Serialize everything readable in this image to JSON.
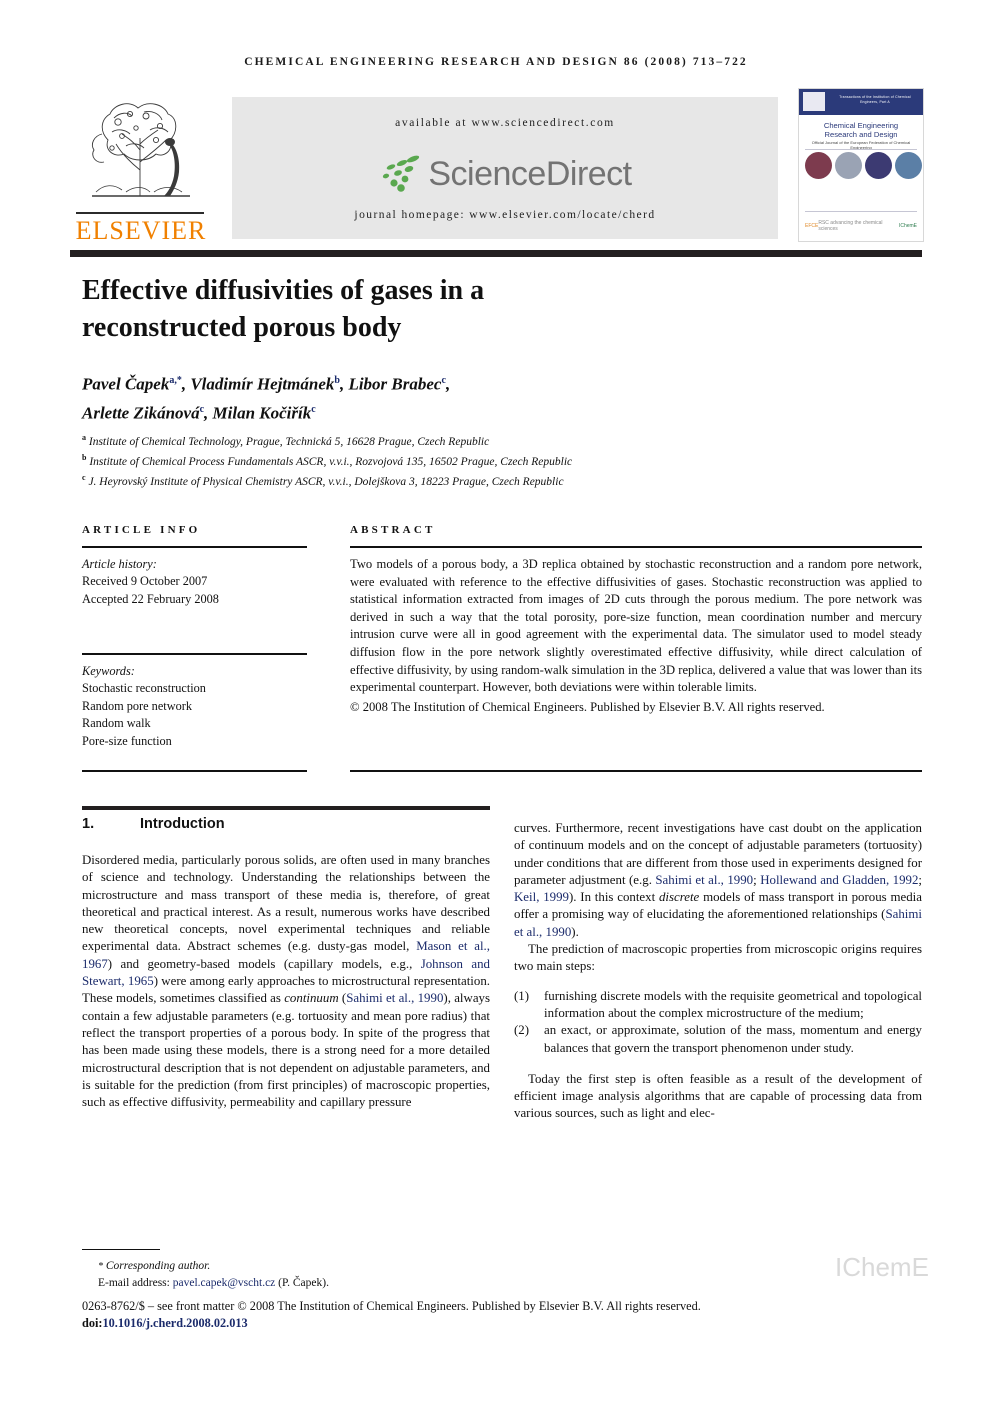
{
  "running_head": "CHEMICAL ENGINEERING RESEARCH AND DESIGN 86 (2008) 713–722",
  "masthead": {
    "publisher_name": "ELSEVIER",
    "available_at": "available at www.sciencedirect.com",
    "sciencedirect_wordmark": "ScienceDirect",
    "journal_homepage": "journal homepage: www.elsevier.com/locate/cherd",
    "cover": {
      "band_text": "Transactions of the Institution of Chemical Engineers, Part A",
      "title_line1": "Chemical Engineering",
      "title_line2": "Research and Design",
      "subtitle": "Official Journal of the European Federation of Chemical Engineering",
      "footer_logos": [
        "EFCE",
        "RSC advancing the chemical sciences",
        "IChemE"
      ]
    }
  },
  "article": {
    "title_line1": "Effective diffusivities of gases in a",
    "title_line2": "reconstructed porous body",
    "authors": [
      {
        "name": "Pavel Čapek",
        "marks": "a,*"
      },
      {
        "name": "Vladimír Hejtmánek",
        "marks": "b"
      },
      {
        "name": "Libor Brabec",
        "marks": "c"
      },
      {
        "name": "Arlette Zikánová",
        "marks": "c"
      },
      {
        "name": "Milan Kočiřík",
        "marks": "c"
      }
    ],
    "affiliations": [
      {
        "mark": "a",
        "text": "Institute of Chemical Technology, Prague, Technická 5, 16628 Prague, Czech Republic"
      },
      {
        "mark": "b",
        "text": "Institute of Chemical Process Fundamentals ASCR, v.v.i., Rozvojová 135, 16502 Prague, Czech Republic"
      },
      {
        "mark": "c",
        "text": "J. Heyrovský Institute of Physical Chemistry ASCR, v.v.i., Dolejškova 3, 18223 Prague, Czech Republic"
      }
    ]
  },
  "article_info": {
    "heading": "ARTICLE INFO",
    "history_label": "Article history:",
    "received": "Received 9 October 2007",
    "accepted": "Accepted 22 February 2008",
    "keywords_label": "Keywords:",
    "keywords": [
      "Stochastic reconstruction",
      "Random pore network",
      "Random walk",
      "Pore-size function"
    ]
  },
  "abstract": {
    "heading": "ABSTRACT",
    "body": "Two models of a porous body, a 3D replica obtained by stochastic reconstruction and a random pore network, were evaluated with reference to the effective diffusivities of gases. Stochastic reconstruction was applied to statistical information extracted from images of 2D cuts through the porous medium. The pore network was derived in such a way that the total porosity, pore-size function, mean coordination number and mercury intrusion curve were all in good agreement with the experimental data. The simulator used to model steady diffusion flow in the pore network slightly overestimated effective diffusivity, while direct calculation of effective diffusivity, by using random-walk simulation in the 3D replica, delivered a value that was lower than its experimental counterpart. However, both deviations were within tolerable limits.",
    "copyright": "© 2008 The Institution of Chemical Engineers. Published by Elsevier B.V. All rights reserved."
  },
  "section": {
    "number": "1.",
    "title": "Introduction"
  },
  "body": {
    "left_p1_a": "Disordered media, particularly porous solids, are often used in many branches of science and technology. Understanding the relationships between the microstructure and mass transport of these media is, therefore, of great theoretical and practical interest. As a result, numerous works have described new theoretical concepts, novel experimental techniques and reliable experimental data. Abstract schemes (e.g. dusty-gas model, ",
    "ref_mason": "Mason et al., 1967",
    "left_p1_b": ") and geometry-based models (capillary models, e.g., ",
    "ref_johnson": "Johnson and Stewart, 1965",
    "left_p1_c": ") were among early approaches to microstructural representation. These models, sometimes classified as ",
    "left_p1_continuum": "continuum",
    "left_p1_d": " (",
    "ref_sahimi1": "Sahimi et al., 1990",
    "left_p1_e": "), always contain a few adjustable parameters (e.g. tortuosity and mean pore radius) that reflect the transport properties of a porous body. In spite of the progress that has been made using these models, there is a strong need for a more detailed microstructural description that is not dependent on adjustable parameters, and is suitable for the prediction (from first principles) of macroscopic properties, such as effective diffusivity, permeability and capillary pressure",
    "right_p1_a": "curves. Furthermore, recent investigations have cast doubt on the application of continuum models and on the concept of adjustable parameters (tortuosity) under conditions that are different from those used in experiments designed for parameter adjustment (e.g. ",
    "ref_sahimi2": "Sahimi et al., 1990",
    "right_sep1": "; ",
    "ref_hollewand": "Hollewand and Gladden, 1992",
    "right_sep2": "; ",
    "ref_keil": "Keil, 1999",
    "right_p1_b": "). In this context ",
    "right_p1_discrete": "discrete",
    "right_p1_c": " models of mass transport in porous media offer a promising way of elucidating the aforementioned relationships (",
    "ref_sahimi3": "Sahimi et al., 1990",
    "right_p1_d": ").",
    "right_p2": "The prediction of macroscopic properties from microscopic origins requires two main steps:",
    "steps": [
      {
        "marker": "(1)",
        "text": "furnishing discrete models with the requisite geometrical and topological information about the complex microstructure of the medium;"
      },
      {
        "marker": "(2)",
        "text": "an exact, or approximate, solution of the mass, momentum and energy balances that govern the transport phenomenon under study."
      }
    ],
    "right_p3": "Today the first step is often feasible as a result of the development of efficient image analysis algorithms that are capable of processing data from various sources, such as light and elec-"
  },
  "footer": {
    "corresponding_marker": "*",
    "corresponding_label": "Corresponding author.",
    "email_label": "E-mail address:",
    "email": "pavel.capek@vscht.cz",
    "email_suffix": "(P. Čapek).",
    "frontmatter": "0263-8762/$ – see front matter © 2008 The Institution of Chemical Engineers. Published by Elsevier B.V. All rights reserved.",
    "doi_label": "doi:",
    "doi": "10.1016/j.cherd.2008.02.013",
    "watermark": "IChemE"
  },
  "colors": {
    "rule_black": "#231f20",
    "link_blue": "#1b2b6b",
    "elsevier_orange": "#f08000",
    "banner_grey": "#e7e7e7",
    "sciencedirect_grey": "#737373",
    "sciencedirect_green": "#5aa84f",
    "cover_navy": "#2b3a7a",
    "watermark_grey": "#d9d9d9"
  }
}
